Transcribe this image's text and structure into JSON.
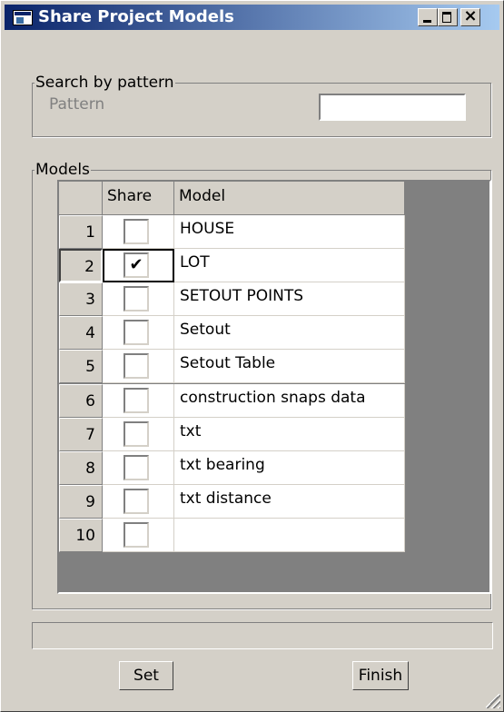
{
  "window": {
    "title": "Share Project Models",
    "close_glyph": "×"
  },
  "search": {
    "group_label": "Search by pattern",
    "pattern_label": "Pattern",
    "pattern_value": ""
  },
  "models": {
    "group_label": "Models",
    "columns": {
      "share": "Share",
      "model": "Model"
    },
    "rows": [
      {
        "num": "1",
        "model": "HOUSE",
        "checked": false
      },
      {
        "num": "2",
        "model": "LOT",
        "checked": true
      },
      {
        "num": "3",
        "model": "SETOUT POINTS",
        "checked": false
      },
      {
        "num": "4",
        "model": "Setout",
        "checked": false
      },
      {
        "num": "5",
        "model": "Setout Table",
        "checked": false
      },
      {
        "num": "6",
        "model": "construction snaps data",
        "checked": false
      },
      {
        "num": "7",
        "model": "txt",
        "checked": false
      },
      {
        "num": "8",
        "model": "txt bearing",
        "checked": false
      },
      {
        "num": "9",
        "model": "txt distance",
        "checked": false
      },
      {
        "num": "10",
        "model": "",
        "checked": false
      }
    ],
    "check_glyph": "✔"
  },
  "status": {
    "text": ""
  },
  "buttons": {
    "set": "Set",
    "finish": "Finish"
  },
  "colors": {
    "title_start": "#0a246a",
    "title_end": "#a6caf0",
    "face": "#d4d0c8"
  }
}
